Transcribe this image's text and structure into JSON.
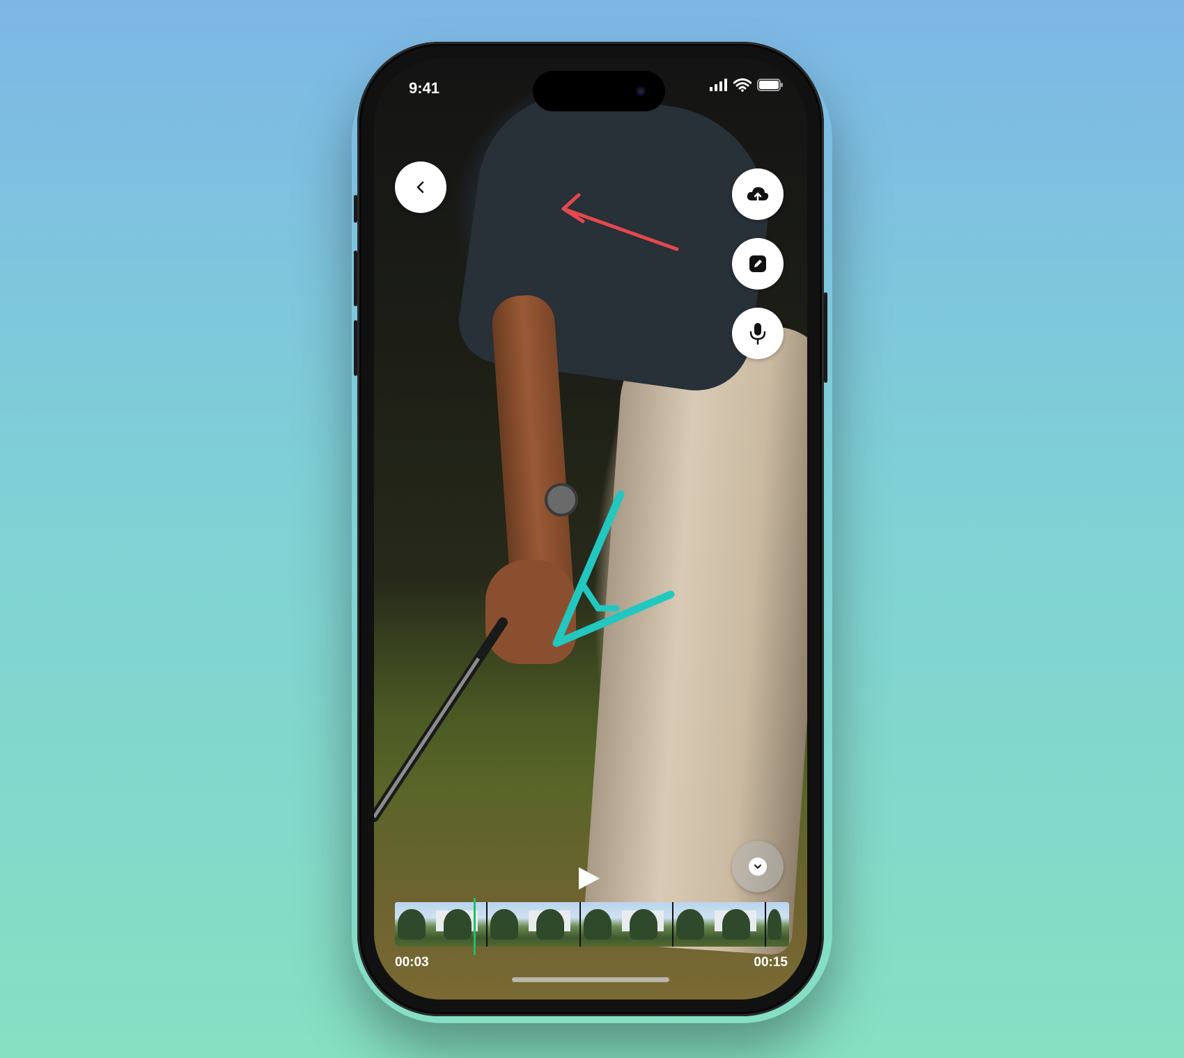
{
  "status_bar": {
    "time": "9:41",
    "icons": [
      "cellular-signal-icon",
      "wifi-icon",
      "battery-icon"
    ]
  },
  "toolbar": {
    "back_icon": "chevron-left-icon",
    "upload_icon": "cloud-upload-icon",
    "draw_icon": "pencil-icon",
    "voice_icon": "microphone-icon",
    "collapse_icon": "chevron-down-icon"
  },
  "annotations": {
    "arrow_color": "#e5484d",
    "angle_color": "#22c7c0"
  },
  "player": {
    "play_icon": "play-icon",
    "current_time": "00:03",
    "duration": "00:15",
    "progress": 0.2,
    "accent": "#1fbf6a"
  }
}
